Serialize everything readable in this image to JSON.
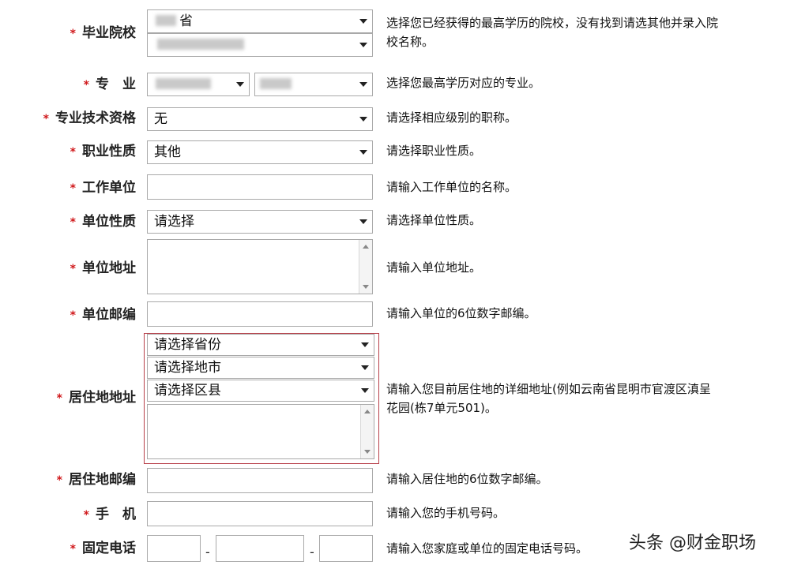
{
  "rows": {
    "school": {
      "label": "毕业院校",
      "province_value": "省",
      "hint_line1": "选择您已经获得的最高学历的院校，没有找到请选其他并录入院",
      "hint_line2": "校名称。"
    },
    "major": {
      "label": "专　业",
      "hint": "选择您最高学历对应的专业。"
    },
    "title": {
      "label": "专业技术资格",
      "value": "无",
      "hint": "请选择相应级别的职称。"
    },
    "career": {
      "label": "职业性质",
      "value": "其他",
      "hint": "请选择职业性质。"
    },
    "employer": {
      "label": "工作单位",
      "value": "",
      "hint": "请输入工作单位的名称。"
    },
    "emp_type": {
      "label": "单位性质",
      "value": "请选择",
      "hint": "请选择单位性质。"
    },
    "emp_addr": {
      "label": "单位地址",
      "value": "",
      "hint": "请输入单位地址。"
    },
    "emp_zip": {
      "label": "单位邮编",
      "value": "",
      "hint": "请输入单位的6位数字邮编。"
    },
    "home_addr": {
      "label": "居住地地址",
      "province": "请选择省份",
      "city": "请选择地市",
      "district": "请选择区县",
      "detail": "",
      "hint_line1": "请输入您目前居住地的详细地址(例如云南省昆明市官渡区滇呈",
      "hint_line2": "花园(栋7单元501)。"
    },
    "home_zip": {
      "label": "居住地邮编",
      "value": "",
      "hint": "请输入居住地的6位数字邮编。"
    },
    "mobile": {
      "label": "手　机",
      "value": "",
      "hint": "请输入您的手机号码。"
    },
    "phone": {
      "label": "固定电话",
      "separator": "-",
      "hint": "请输入您家庭或单位的固定电话号码。"
    }
  },
  "required_mark": "*",
  "watermark": "头条 @财金职场"
}
